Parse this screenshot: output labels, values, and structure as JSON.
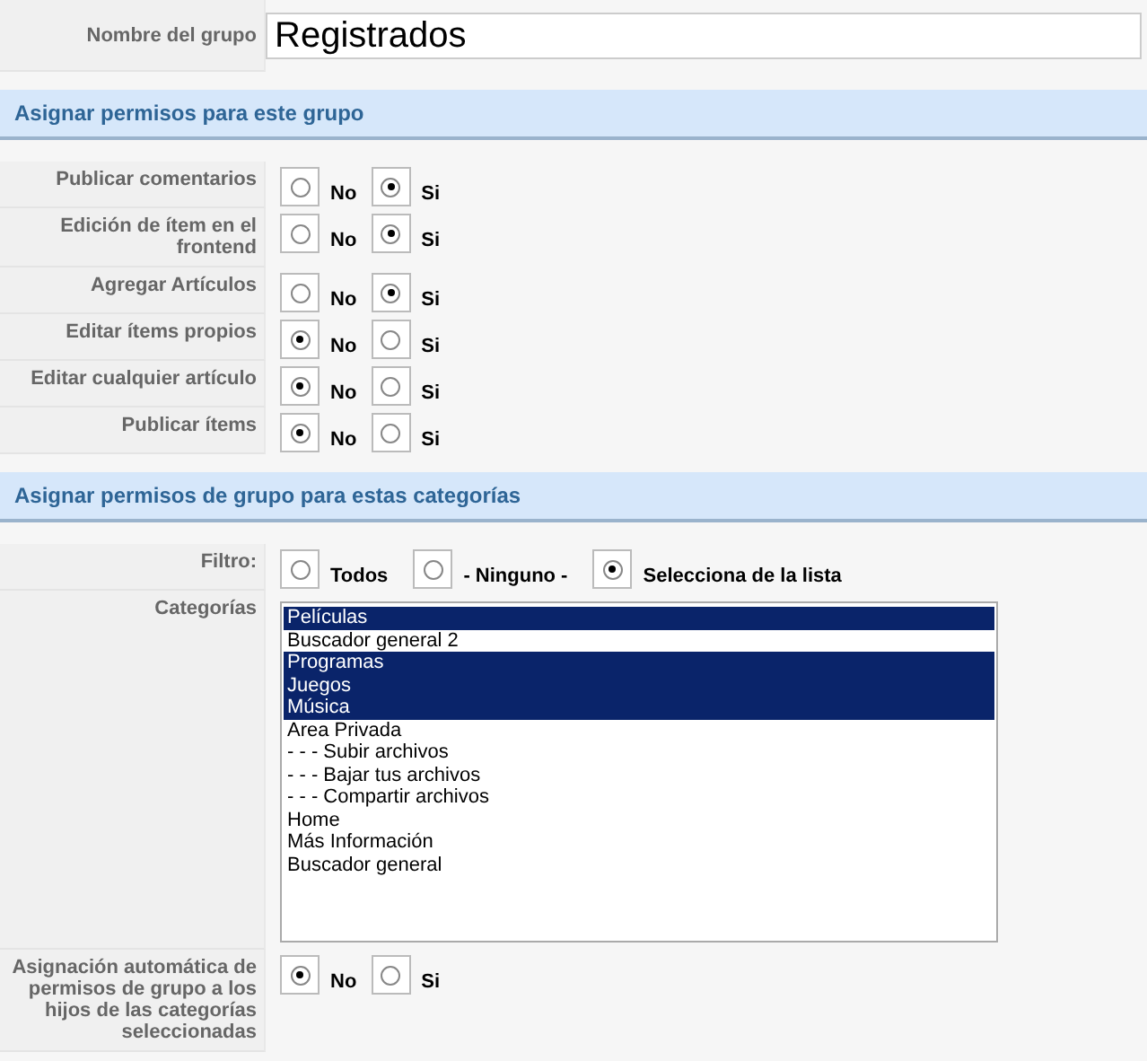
{
  "group_name": {
    "label": "Nombre del grupo",
    "value": "Registrados"
  },
  "permissions": {
    "title": "Asignar permisos para este grupo",
    "rows": [
      {
        "label": "Publicar comentarios",
        "options": [
          {
            "label": "No",
            "selected": false
          },
          {
            "label": "Si",
            "selected": true
          }
        ]
      },
      {
        "label": "Edición de ítem en el frontend",
        "options": [
          {
            "label": "No",
            "selected": false
          },
          {
            "label": "Si",
            "selected": true
          }
        ]
      },
      {
        "label": "Agregar Artículos",
        "options": [
          {
            "label": "No",
            "selected": false
          },
          {
            "label": "Si",
            "selected": true
          }
        ]
      },
      {
        "label": "Editar ítems propios",
        "options": [
          {
            "label": "No",
            "selected": true
          },
          {
            "label": "Si",
            "selected": false
          }
        ]
      },
      {
        "label": "Editar cualquier artículo",
        "options": [
          {
            "label": "No",
            "selected": true
          },
          {
            "label": "Si",
            "selected": false
          }
        ]
      },
      {
        "label": "Publicar ítems",
        "options": [
          {
            "label": "No",
            "selected": true
          },
          {
            "label": "Si",
            "selected": false
          }
        ]
      }
    ]
  },
  "categories_section": {
    "title": "Asignar permisos de grupo para estas categorías",
    "filter": {
      "label": "Filtro:",
      "options": [
        {
          "label": "Todos",
          "selected": false
        },
        {
          "label": "- Ninguno -",
          "selected": false
        },
        {
          "label": "Selecciona de la lista",
          "selected": true
        }
      ]
    },
    "categories": {
      "label": "Categorías",
      "items": [
        {
          "label": "Películas",
          "selected": true
        },
        {
          "label": "Buscador general 2",
          "selected": false
        },
        {
          "label": "Programas",
          "selected": true
        },
        {
          "label": "Juegos",
          "selected": true
        },
        {
          "label": "Música",
          "selected": true
        },
        {
          "label": "Area Privada",
          "selected": false
        },
        {
          "label": "- - - Subir archivos",
          "selected": false
        },
        {
          "label": "- - - Bajar tus archivos",
          "selected": false
        },
        {
          "label": "- - - Compartir archivos",
          "selected": false
        },
        {
          "label": "Home",
          "selected": false
        },
        {
          "label": "Más Información",
          "selected": false
        },
        {
          "label": "Buscador general",
          "selected": false
        }
      ]
    },
    "auto_assign": {
      "label": "Asignación automática de permisos de grupo a los hijos de las categorías seleccionadas",
      "options": [
        {
          "label": "No",
          "selected": true
        },
        {
          "label": "Si",
          "selected": false
        }
      ]
    }
  }
}
